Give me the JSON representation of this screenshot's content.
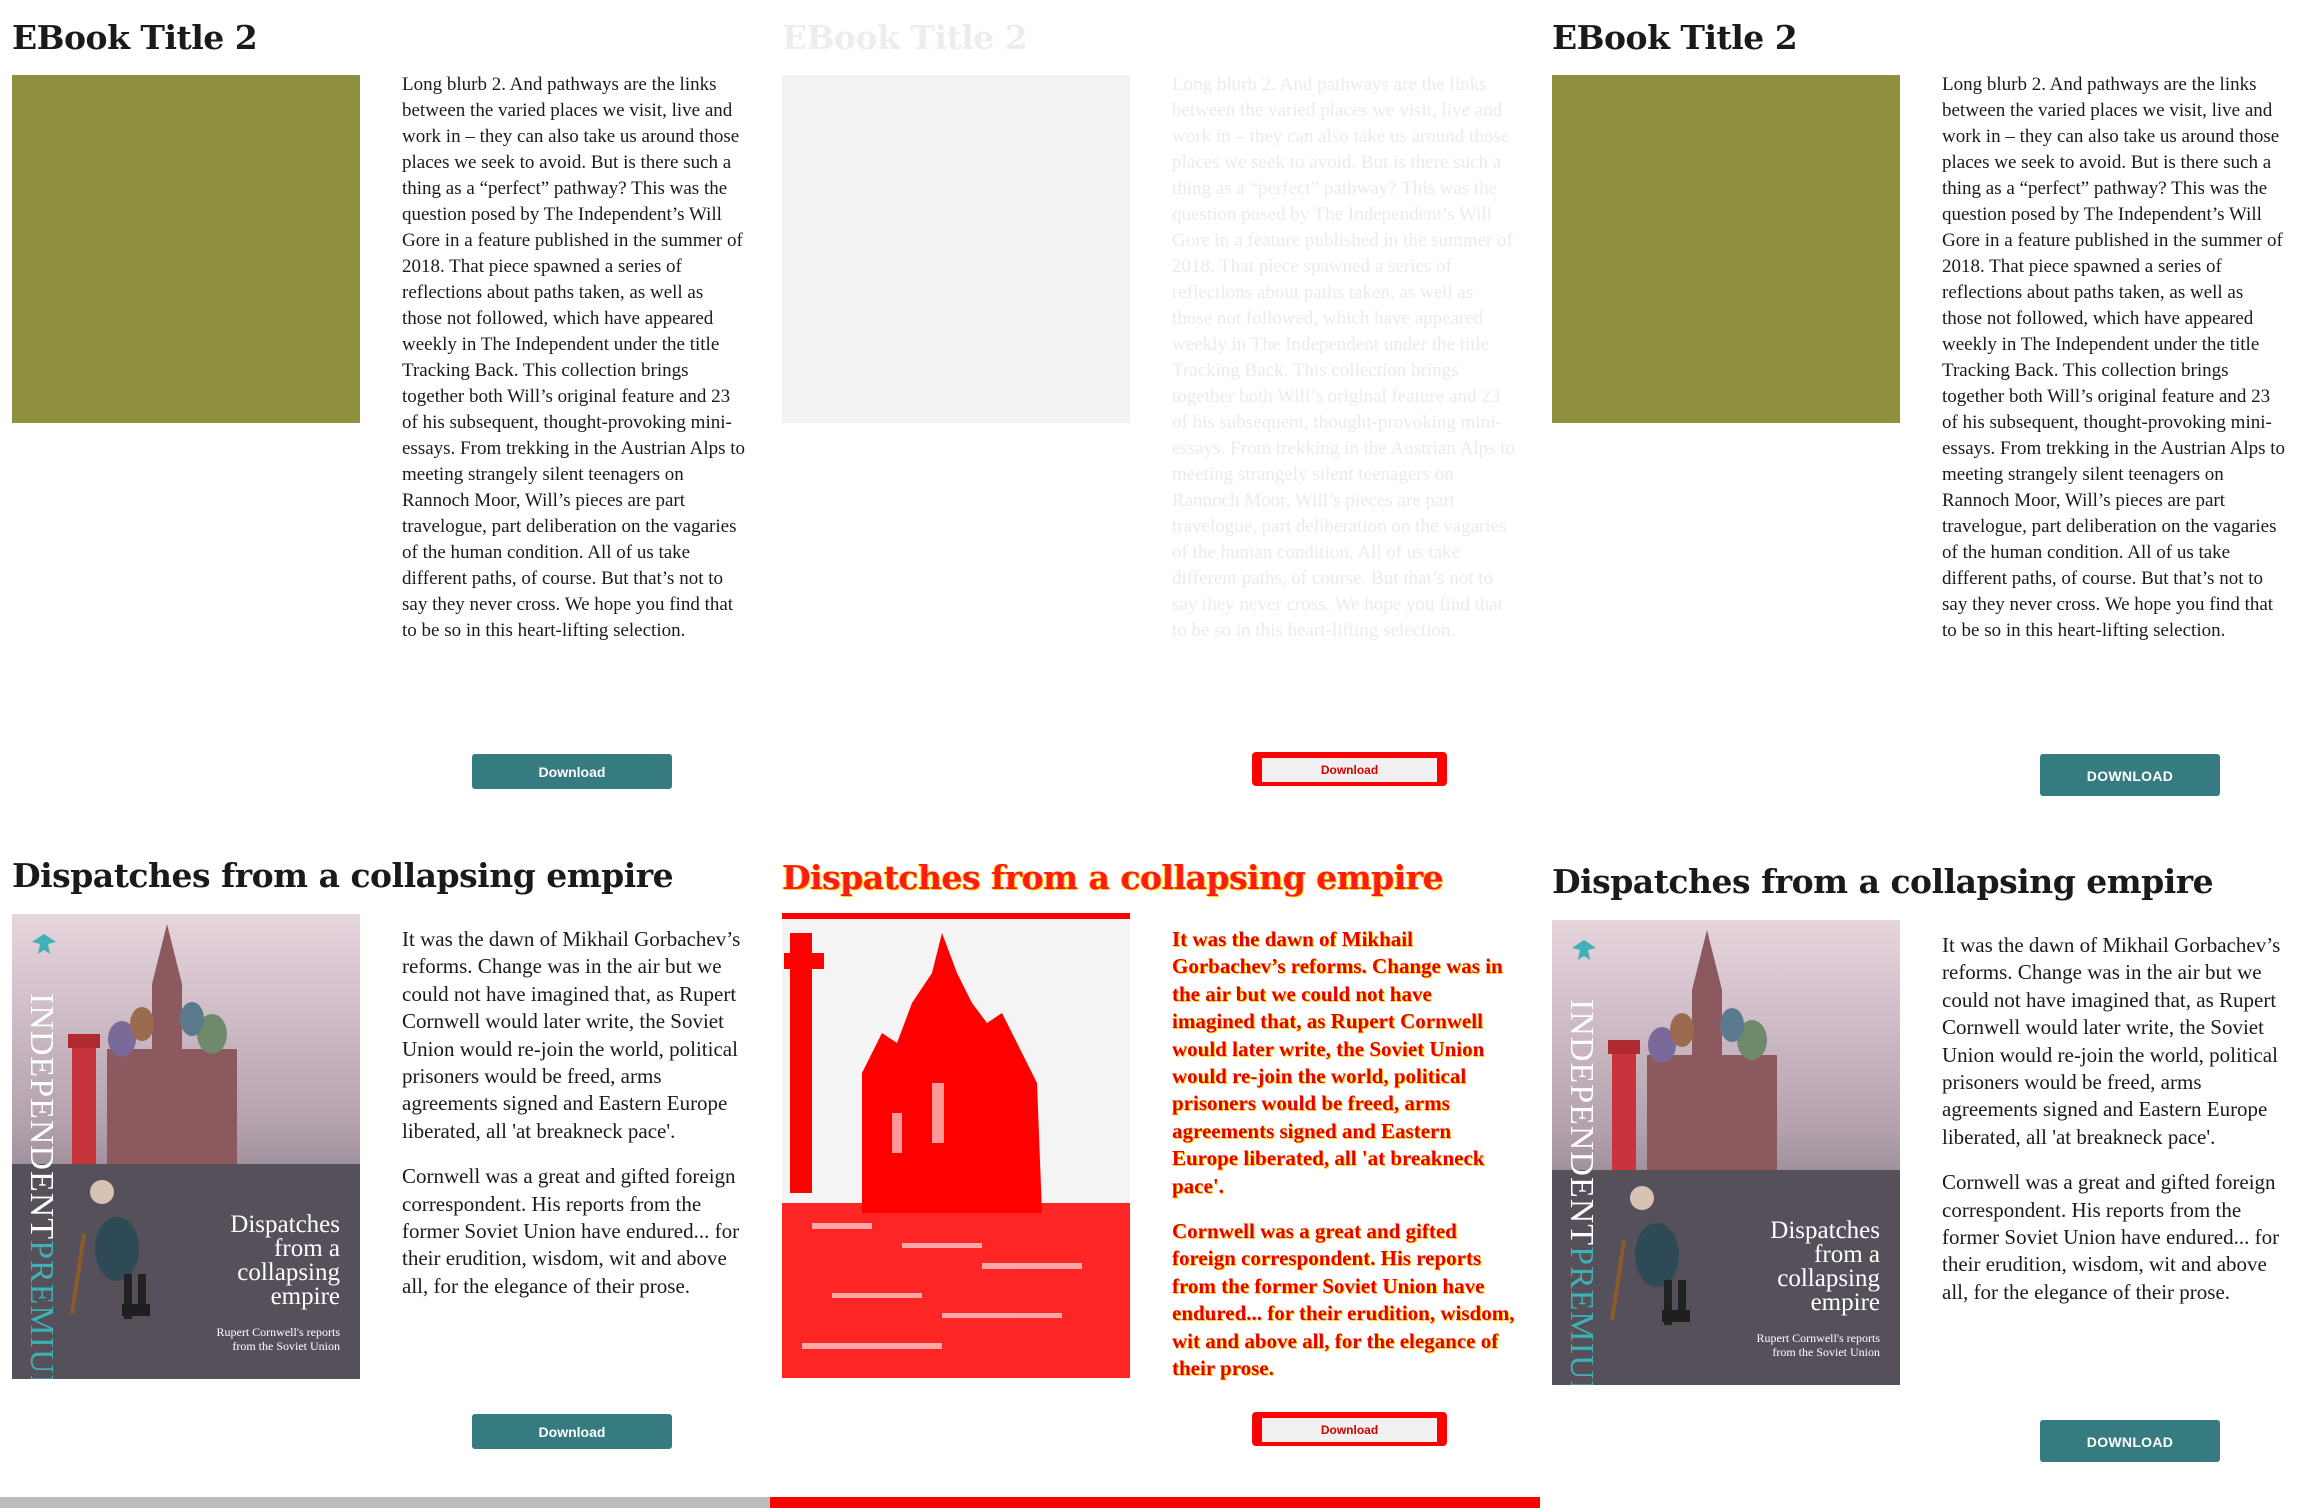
{
  "ebook": {
    "title": "EBook Title 2",
    "blurb": "Long blurb 2. And pathways are the links between the varied places we visit, live and work in – they can also take us around those places we seek to avoid. But is there such a thing as a “perfect” pathway? This was the question posed by The Independent’s Will Gore in a feature published in the summer of 2018. That piece spawned a series of reflections about paths taken, as well as those not followed, which have appeared weekly in The Independent under the title Tracking Back. This collection brings together both Will’s original feature and 23 of his subsequent, thought-provoking mini-essays. From trekking in the Austrian Alps to meeting strangely silent teenagers on Rannoch Moor, Will’s pieces are part travelogue, part deliberation on the vagaries of the human condition. All of us take different paths, of course. But that’s not to say they never cross. We hope you find that to be so in this heart-lifting selection.",
    "cover_color": "#8f903d"
  },
  "dispatches": {
    "title": "Dispatches from a collapsing empire",
    "para1": "It was the dawn of Mikhail Gorbachev’s reforms. Change was in the air but we could not have imagined that, as Rupert Cornwell would later write, the Soviet Union would re-join the world, political prisoners would be freed, arms agreements signed and Eastern Europe liberated, all 'at breakneck pace'.",
    "para2": "Cornwell was a great and gifted foreign correspondent. His reports from the former Soviet Union have endured... for their erudition, wisdom, wit and above all, for the elegance of their prose.",
    "cover": {
      "brand_main": "INDEPENDENT",
      "brand_accent": "PREMIUM",
      "title_lines": [
        "Dispatches",
        "from a",
        "collapsing",
        "empire"
      ],
      "subtitle_lines": [
        "Rupert Cornwell's reports",
        "from the Soviet Union"
      ]
    }
  },
  "buttons": {
    "download_cased": "Download",
    "download_upper": "DOWNLOAD",
    "diff_label": "Download",
    "accent_color": "#367b80"
  },
  "bottom_bar": {
    "left_color": "#bdbdbd",
    "right_color": "#ff0000"
  }
}
